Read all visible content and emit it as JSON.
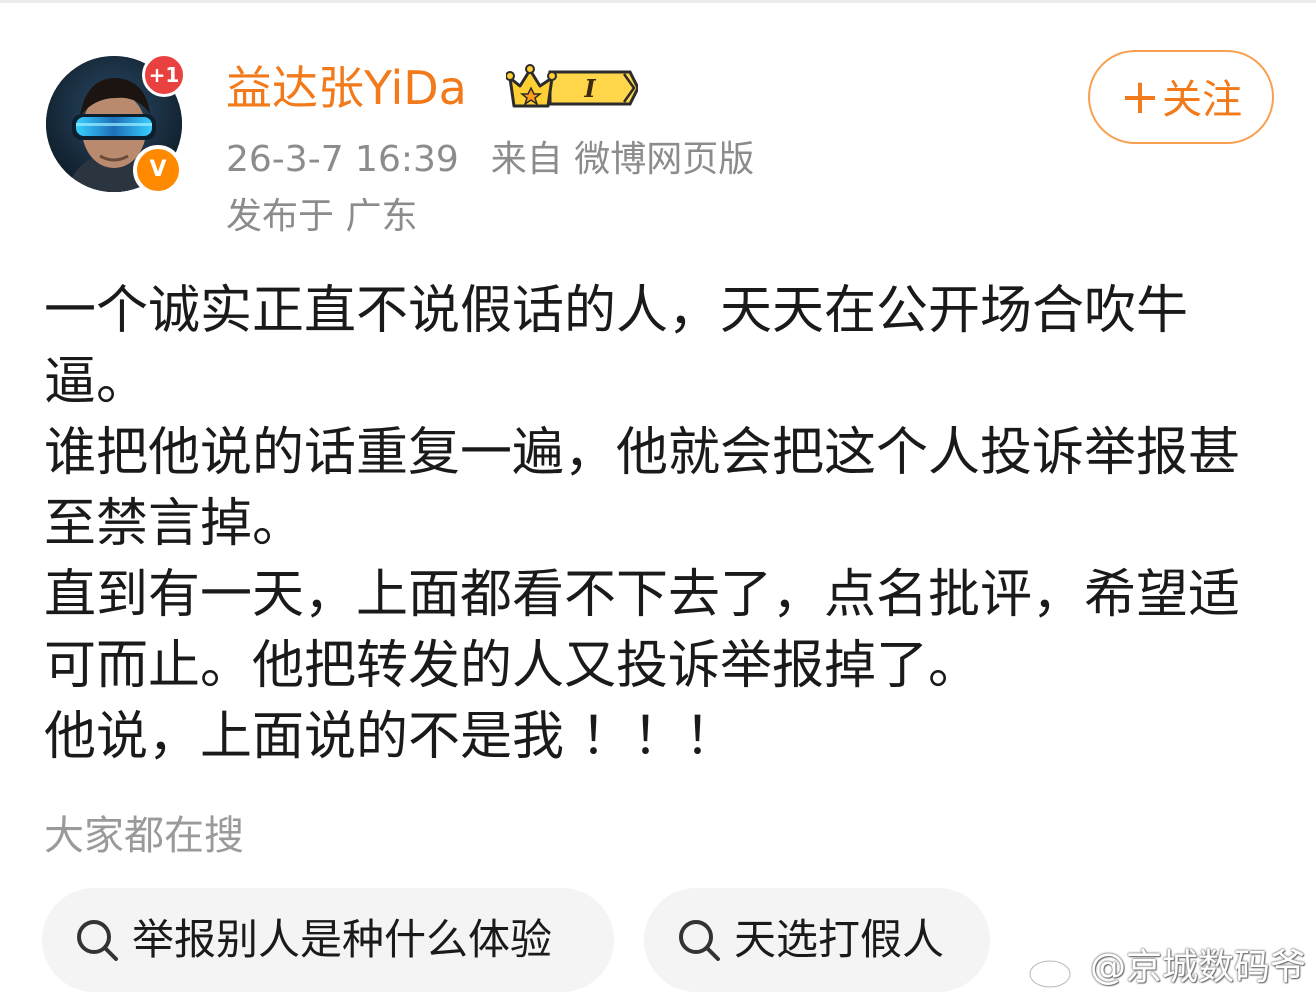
{
  "post": {
    "author": {
      "name": "益达张YiDa",
      "badge_count": "+1",
      "verified_mark": "V",
      "level_mark": "I"
    },
    "meta": {
      "time": "26-3-7 16:39",
      "source_prefix": "来自",
      "source": "微博网页版",
      "location": "发布于 广东"
    },
    "follow": {
      "plus": "+",
      "label": "关注"
    },
    "lines": [
      "一个诚实正直不说假话的人，天天在公开场合吹牛",
      "逼。",
      "谁把他说的话重复一遍，他就会把这个人投诉举报甚",
      "至禁言掉。",
      "直到有一天，上面都看不下去了，点名批评，希望适",
      "可而止。他把转发的人又投诉举报掉了。",
      "他说，上面说的不是我 ！！！"
    ]
  },
  "hot_search": {
    "title": "大家都在搜",
    "items": [
      {
        "label": "举报别人是种什么体验",
        "icon": "search-icon"
      },
      {
        "label": "天选打假人",
        "icon": "search-icon"
      }
    ]
  },
  "watermark": {
    "text": "@京城数码爷",
    "icon": "weibo-logo-icon"
  },
  "colors": {
    "accent": "#f27a1a",
    "meta_gray": "#8c8c8c",
    "pill_bg": "#f4f4f4",
    "badge_red": "#e9413f",
    "verified_orange": "#ff8a00"
  }
}
